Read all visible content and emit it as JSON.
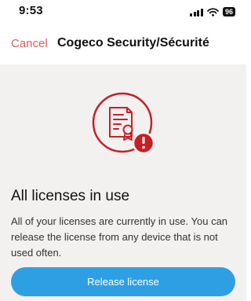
{
  "status_bar": {
    "time": "9:53",
    "battery": "96",
    "icons": [
      "signal-icon",
      "wifi-icon",
      "battery-icon"
    ]
  },
  "nav": {
    "cancel_label": "Cancel",
    "title": "Cogeco Security/Sécurité"
  },
  "message": {
    "illustration_icon": "certificate-alert-icon",
    "heading": "All licenses in use",
    "body": "All of your licenses are currently in use. You can release the license from any device that is not used often."
  },
  "actions": {
    "release_label": "Release license"
  },
  "colors": {
    "accent_red": "#c62027",
    "cancel_red": "#e35b5b",
    "button_blue": "#2f9fe3",
    "content_background": "#f3f1f0"
  }
}
